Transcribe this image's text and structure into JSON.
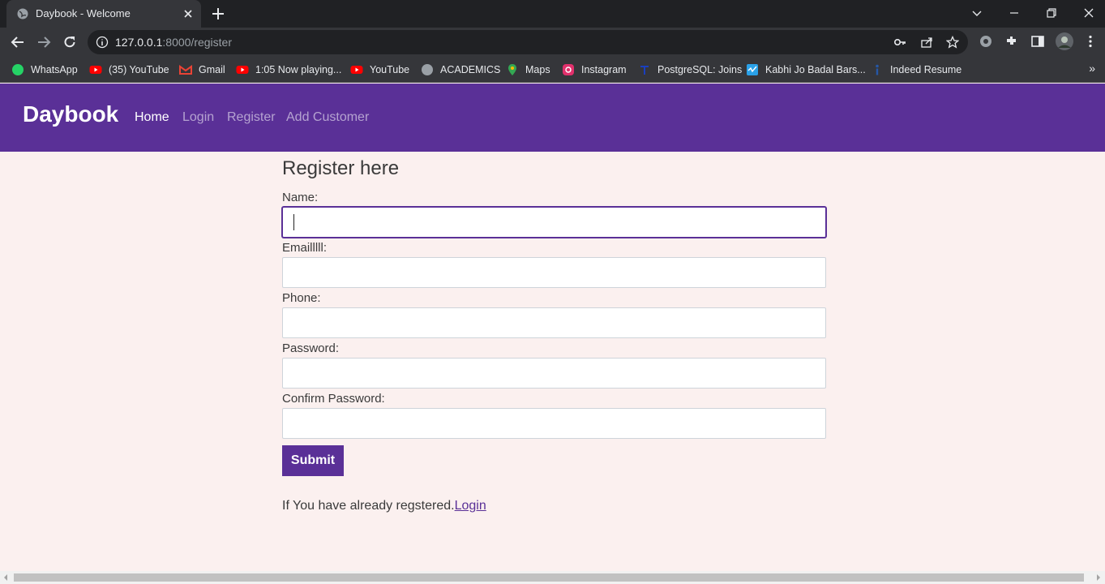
{
  "browser": {
    "tab_title": "Daybook - Welcome",
    "url_host": "127.0.0.1",
    "url_path": ":8000/register"
  },
  "bookmarks": [
    {
      "label": "WhatsApp",
      "icon": "whatsapp-icon",
      "color": "#25d366"
    },
    {
      "label": "(35) YouTube",
      "icon": "youtube-icon",
      "color": "#ff0000"
    },
    {
      "label": "Gmail",
      "icon": "gmail-icon",
      "color": "#ea4335"
    },
    {
      "label": "1:05 Now playing...",
      "icon": "youtube-icon",
      "color": "#ff0000"
    },
    {
      "label": "YouTube",
      "icon": "youtube-icon",
      "color": "#ff0000"
    },
    {
      "label": "ACADEMICS",
      "icon": "globe-icon",
      "color": "#9aa0a6"
    },
    {
      "label": "Maps",
      "icon": "maps-icon",
      "color": "#34a853"
    },
    {
      "label": "Instagram",
      "icon": "instagram-icon",
      "color": "#e1306c"
    },
    {
      "label": "PostgreSQL: Joins",
      "icon": "tpoint-icon",
      "color": "#1a3fbf"
    },
    {
      "label": "Kabhi Jo Badal Bars...",
      "icon": "music-icon",
      "color": "#2aa1e8"
    },
    {
      "label": "Indeed Resume",
      "icon": "indeed-icon",
      "color": "#2557a7"
    }
  ],
  "site": {
    "brand": "Daybook",
    "nav": [
      "Home",
      "Login",
      "Register",
      "Add Customer"
    ],
    "accent": "#5a3097"
  },
  "form": {
    "title": "Register here",
    "fields": [
      "Name:",
      "Emailllll:",
      "Phone:",
      "Password:",
      "Confirm Password:"
    ],
    "submit": "Submit",
    "already_text": "If You have already regstered.",
    "login_link": "Login"
  }
}
